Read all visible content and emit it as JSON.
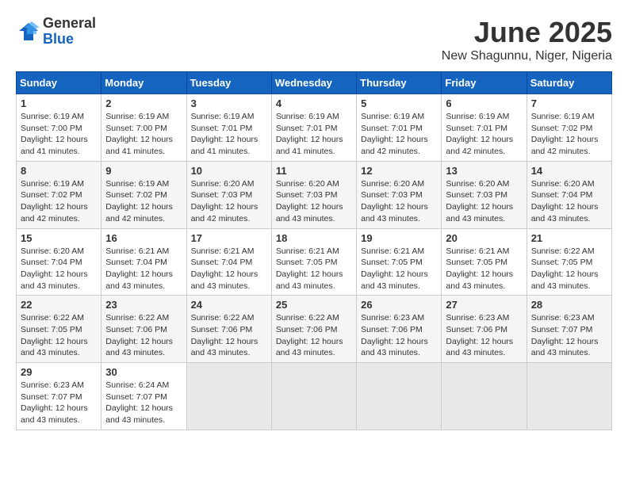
{
  "header": {
    "logo_general": "General",
    "logo_blue": "Blue",
    "month_title": "June 2025",
    "location": "New Shagunnu, Niger, Nigeria"
  },
  "weekdays": [
    "Sunday",
    "Monday",
    "Tuesday",
    "Wednesday",
    "Thursday",
    "Friday",
    "Saturday"
  ],
  "weeks": [
    [
      {
        "day": "1",
        "sunrise": "6:19 AM",
        "sunset": "7:00 PM",
        "daylight": "12 hours and 41 minutes"
      },
      {
        "day": "2",
        "sunrise": "6:19 AM",
        "sunset": "7:00 PM",
        "daylight": "12 hours and 41 minutes"
      },
      {
        "day": "3",
        "sunrise": "6:19 AM",
        "sunset": "7:01 PM",
        "daylight": "12 hours and 41 minutes"
      },
      {
        "day": "4",
        "sunrise": "6:19 AM",
        "sunset": "7:01 PM",
        "daylight": "12 hours and 41 minutes"
      },
      {
        "day": "5",
        "sunrise": "6:19 AM",
        "sunset": "7:01 PM",
        "daylight": "12 hours and 42 minutes"
      },
      {
        "day": "6",
        "sunrise": "6:19 AM",
        "sunset": "7:01 PM",
        "daylight": "12 hours and 42 minutes"
      },
      {
        "day": "7",
        "sunrise": "6:19 AM",
        "sunset": "7:02 PM",
        "daylight": "12 hours and 42 minutes"
      }
    ],
    [
      {
        "day": "8",
        "sunrise": "6:19 AM",
        "sunset": "7:02 PM",
        "daylight": "12 hours and 42 minutes"
      },
      {
        "day": "9",
        "sunrise": "6:19 AM",
        "sunset": "7:02 PM",
        "daylight": "12 hours and 42 minutes"
      },
      {
        "day": "10",
        "sunrise": "6:20 AM",
        "sunset": "7:03 PM",
        "daylight": "12 hours and 42 minutes"
      },
      {
        "day": "11",
        "sunrise": "6:20 AM",
        "sunset": "7:03 PM",
        "daylight": "12 hours and 43 minutes"
      },
      {
        "day": "12",
        "sunrise": "6:20 AM",
        "sunset": "7:03 PM",
        "daylight": "12 hours and 43 minutes"
      },
      {
        "day": "13",
        "sunrise": "6:20 AM",
        "sunset": "7:03 PM",
        "daylight": "12 hours and 43 minutes"
      },
      {
        "day": "14",
        "sunrise": "6:20 AM",
        "sunset": "7:04 PM",
        "daylight": "12 hours and 43 minutes"
      }
    ],
    [
      {
        "day": "15",
        "sunrise": "6:20 AM",
        "sunset": "7:04 PM",
        "daylight": "12 hours and 43 minutes"
      },
      {
        "day": "16",
        "sunrise": "6:21 AM",
        "sunset": "7:04 PM",
        "daylight": "12 hours and 43 minutes"
      },
      {
        "day": "17",
        "sunrise": "6:21 AM",
        "sunset": "7:04 PM",
        "daylight": "12 hours and 43 minutes"
      },
      {
        "day": "18",
        "sunrise": "6:21 AM",
        "sunset": "7:05 PM",
        "daylight": "12 hours and 43 minutes"
      },
      {
        "day": "19",
        "sunrise": "6:21 AM",
        "sunset": "7:05 PM",
        "daylight": "12 hours and 43 minutes"
      },
      {
        "day": "20",
        "sunrise": "6:21 AM",
        "sunset": "7:05 PM",
        "daylight": "12 hours and 43 minutes"
      },
      {
        "day": "21",
        "sunrise": "6:22 AM",
        "sunset": "7:05 PM",
        "daylight": "12 hours and 43 minutes"
      }
    ],
    [
      {
        "day": "22",
        "sunrise": "6:22 AM",
        "sunset": "7:05 PM",
        "daylight": "12 hours and 43 minutes"
      },
      {
        "day": "23",
        "sunrise": "6:22 AM",
        "sunset": "7:06 PM",
        "daylight": "12 hours and 43 minutes"
      },
      {
        "day": "24",
        "sunrise": "6:22 AM",
        "sunset": "7:06 PM",
        "daylight": "12 hours and 43 minutes"
      },
      {
        "day": "25",
        "sunrise": "6:22 AM",
        "sunset": "7:06 PM",
        "daylight": "12 hours and 43 minutes"
      },
      {
        "day": "26",
        "sunrise": "6:23 AM",
        "sunset": "7:06 PM",
        "daylight": "12 hours and 43 minutes"
      },
      {
        "day": "27",
        "sunrise": "6:23 AM",
        "sunset": "7:06 PM",
        "daylight": "12 hours and 43 minutes"
      },
      {
        "day": "28",
        "sunrise": "6:23 AM",
        "sunset": "7:07 PM",
        "daylight": "12 hours and 43 minutes"
      }
    ],
    [
      {
        "day": "29",
        "sunrise": "6:23 AM",
        "sunset": "7:07 PM",
        "daylight": "12 hours and 43 minutes"
      },
      {
        "day": "30",
        "sunrise": "6:24 AM",
        "sunset": "7:07 PM",
        "daylight": "12 hours and 43 minutes"
      },
      null,
      null,
      null,
      null,
      null
    ]
  ]
}
